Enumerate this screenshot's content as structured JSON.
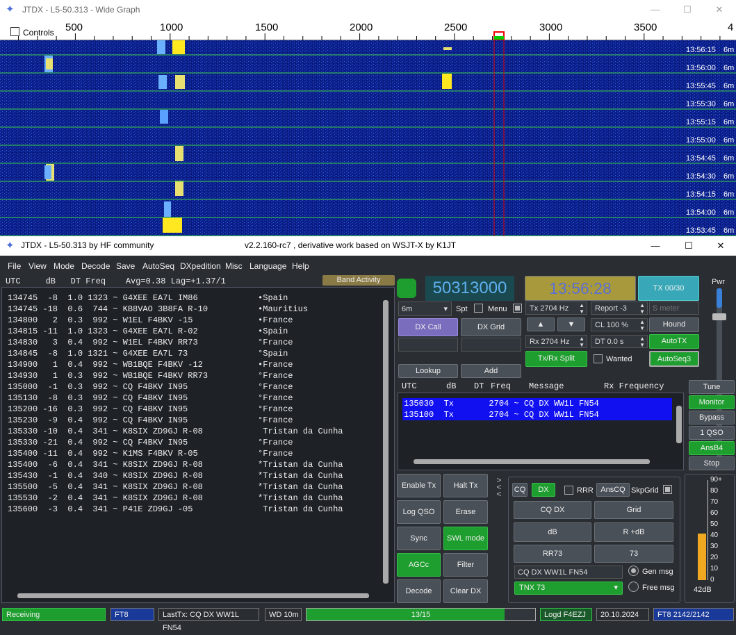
{
  "wide_graph": {
    "title": "JTDX - L5-50.313 - Wide Graph",
    "controls_label": "Controls",
    "freq_ticks": [
      "500",
      "1000",
      "1500",
      "2000",
      "2500",
      "3000",
      "3500",
      "4"
    ],
    "rows": [
      {
        "time": "13:56:15",
        "band": "6m"
      },
      {
        "time": "13:56:00",
        "band": "6m"
      },
      {
        "time": "13:55:45",
        "band": "6m"
      },
      {
        "time": "13:55:30",
        "band": "6m"
      },
      {
        "time": "13:55:15",
        "band": "6m"
      },
      {
        "time": "13:55:00",
        "band": "6m"
      },
      {
        "time": "13:54:45",
        "band": "6m"
      },
      {
        "time": "13:54:30",
        "band": "6m"
      },
      {
        "time": "13:54:15",
        "band": "6m"
      },
      {
        "time": "13:54:00",
        "band": "6m"
      },
      {
        "time": "13:53:45",
        "band": "6m"
      }
    ]
  },
  "main": {
    "title": "JTDX - L5-50.313  by HF community",
    "subtitle": "v2.2.160-rc7 , derivative work based on WSJT-X by K1JT"
  },
  "menu": [
    "File",
    "View",
    "Mode",
    "Decode",
    "Save",
    "AutoSeq",
    "DXpedition",
    "Misc",
    "Language",
    "Help"
  ],
  "band_activity": {
    "header": "UTC     dB   DT Freq    Avg=0.38 Lag=+1.37/1",
    "button": "Band Activity",
    "rows": [
      "134745  -8  1.0 1323 ~ G4XEE EA7L IM86            •Spain",
      "134745 -18  0.6  744 ~ KB8VAO 3B8FA R-10          •Mauritius",
      "134800   2  0.3  992 ~ W1EL F4BKV -15             •France",
      "134815 -11  1.0 1323 ~ G4XEE EA7L R-02            •Spain",
      "134830   3  0.4  992 ~ W1EL F4BKV RR73            °France",
      "134845  -8  1.0 1321 ~ G4XEE EA7L 73              °Spain",
      "134900   1  0.4  992 ~ WB1BQE F4BKV -12           •France",
      "134930   1  0.3  992 ~ WB1BQE F4BKV RR73          °France",
      "135000  -1  0.3  992 ~ CQ F4BKV IN95              °France",
      "135130  -8  0.3  992 ~ CQ F4BKV IN95              °France",
      "135200 -16  0.3  992 ~ CQ F4BKV IN95              °France",
      "135230  -9  0.4  992 ~ CQ F4BKV IN95              °France",
      "135330 -10  0.4  341 ~ K8SIX ZD9GJ R-08            Tristan da Cunha",
      "135330 -21  0.4  992 ~ CQ F4BKV IN95              °France",
      "135400 -11  0.4  992 ~ K1MS F4BKV R-05            °France",
      "135400  -6  0.4  341 ~ K8SIX ZD9GJ R-08           *Tristan da Cunha",
      "135430  -1  0.4  340 ~ K8SIX ZD9GJ R-08           *Tristan da Cunha",
      "135500  -5  0.4  341 ~ K8SIX ZD9GJ R-08           *Tristan da Cunha",
      "135530  -2  0.4  341 ~ K8SIX ZD9GJ R-08           *Tristan da Cunha",
      "135600  -3  0.4  341 ~ P41E ZD9GJ -05              Tristan da Cunha"
    ]
  },
  "controls": {
    "freq": "50313000",
    "time": "13:56:28",
    "tx_counter": "TX 00/30",
    "band": "6m",
    "spt": "Spt",
    "menu": "Menu",
    "dx_call": "DX Call",
    "dx_grid": "DX Grid",
    "tx_hz": "Tx  2704 Hz",
    "rx_hz": "Rx  2704 Hz",
    "report": "Report -3",
    "s_meter": "S meter",
    "cl": "CL  100 %",
    "hound": "Hound",
    "dt": "DT 0.0 s",
    "autotx": "AutoTX",
    "txrx_split": "Tx/Rx Split",
    "wanted": "Wanted",
    "autoseq3": "AutoSeq3",
    "lookup": "Lookup",
    "add": "Add",
    "pwr": "Pwr"
  },
  "rx_freq": {
    "header": {
      "utc": "UTC",
      "db": "dB",
      "dt": "DT",
      "freq": "Freq",
      "msg": "Message",
      "title": "Rx Frequency"
    },
    "rows": [
      "135030  Tx       2704 ~ CQ DX WW1L FN54",
      "135100  Tx       2704 ~ CQ DX WW1L FN54"
    ]
  },
  "side_buttons": [
    "Tune",
    "Monitor",
    "Bypass",
    "1 QSO",
    "AnsB4",
    "Stop"
  ],
  "bottom_left": [
    [
      "Enable Tx",
      "Halt Tx"
    ],
    [
      "Log QSO",
      "Erase"
    ],
    [
      "Sync",
      "SWL mode"
    ],
    [
      "AGCc",
      "Filter"
    ],
    [
      "Decode",
      "Clear DX"
    ]
  ],
  "tx_panel": {
    "cq": "CQ",
    "dx": "DX",
    "rrr": "RRR",
    "anscq": "AnsCQ",
    "skpgrid": "SkpGrid",
    "b1": "CQ DX",
    "b2": "Grid",
    "b3": "dB",
    "b4": "R +dB",
    "b5": "RR73",
    "b6": "73",
    "msg1": "CQ DX WW1L FN54",
    "msg2": "TNX 73",
    "gen": "Gen msg",
    "free": "Free msg"
  },
  "meter": {
    "ticks": [
      "90+",
      "80",
      "70",
      "60",
      "50",
      "40",
      "30",
      "20",
      "10",
      "0"
    ],
    "level_db": 42,
    "label": "42dB"
  },
  "status": {
    "state": "Receiving",
    "mode": "FT8",
    "last_tx": "LastTx: CQ DX WW1L FN54",
    "wd": "WD 10m",
    "progress": "13/15",
    "progress_value": 0.867,
    "logd": "Logd F4EZJ",
    "date": "20.10.2024",
    "count": "FT8  2142/2142"
  }
}
